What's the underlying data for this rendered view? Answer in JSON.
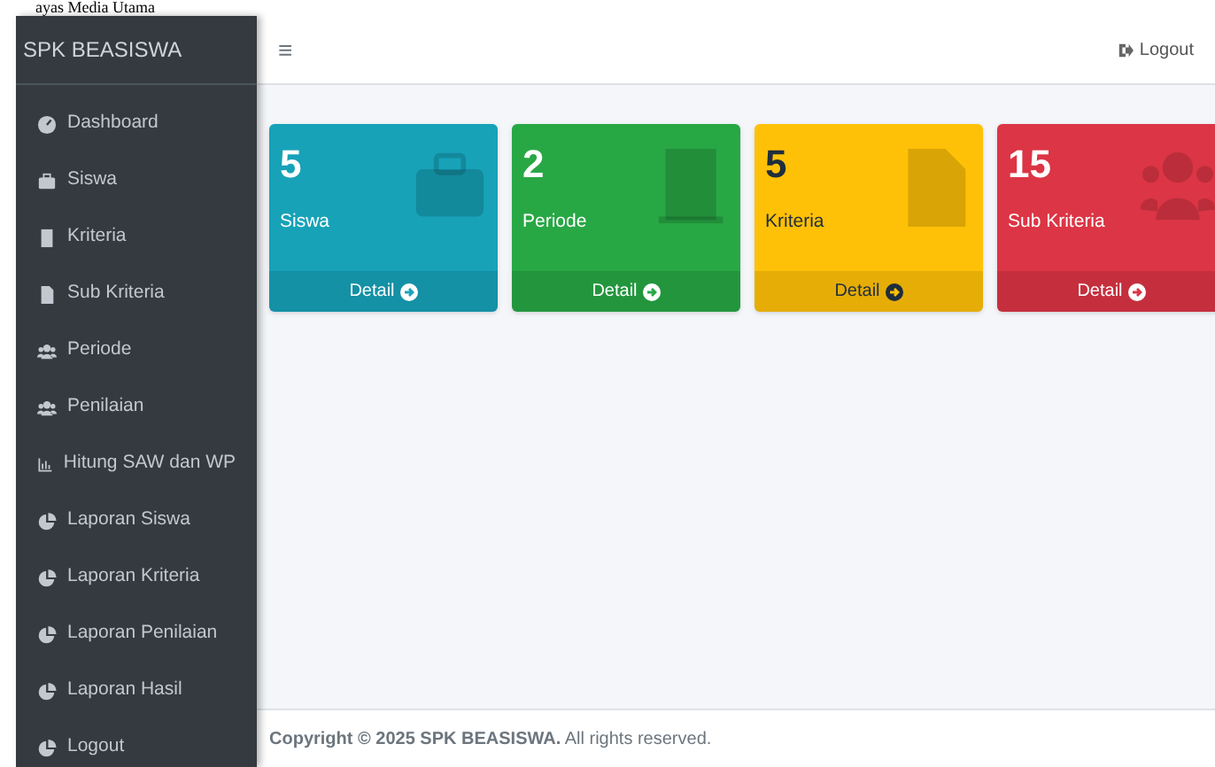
{
  "caption": "ayas Media Utama",
  "brand": "SPK BEASISWA",
  "navbar": {
    "menu_icon": "≡",
    "logout": "Logout"
  },
  "sidebar": {
    "items": [
      {
        "label": "Dashboard"
      },
      {
        "label": "Siswa"
      },
      {
        "label": "Kriteria"
      },
      {
        "label": "Sub Kriteria"
      },
      {
        "label": "Periode"
      },
      {
        "label": "Penilaian"
      },
      {
        "label": "Hitung SAW dan WP"
      },
      {
        "label": "Laporan Siswa"
      },
      {
        "label": "Laporan Kriteria"
      },
      {
        "label": "Laporan Penilaian"
      },
      {
        "label": "Laporan Hasil"
      },
      {
        "label": "Logout"
      }
    ]
  },
  "cards": [
    {
      "value": "5",
      "label": "Siswa",
      "link": "Detail",
      "color": "#17a2b8"
    },
    {
      "value": "2",
      "label": "Periode",
      "link": "Detail",
      "color": "#28a745"
    },
    {
      "value": "5",
      "label": "Kriteria",
      "link": "Detail",
      "color": "#ffc107"
    },
    {
      "value": "15",
      "label": "Sub Kriteria",
      "link": "Detail",
      "color": "#dc3545"
    }
  ],
  "footer": "**Copyright © 2025 SPK BEASISWA.** All rights reserved."
}
